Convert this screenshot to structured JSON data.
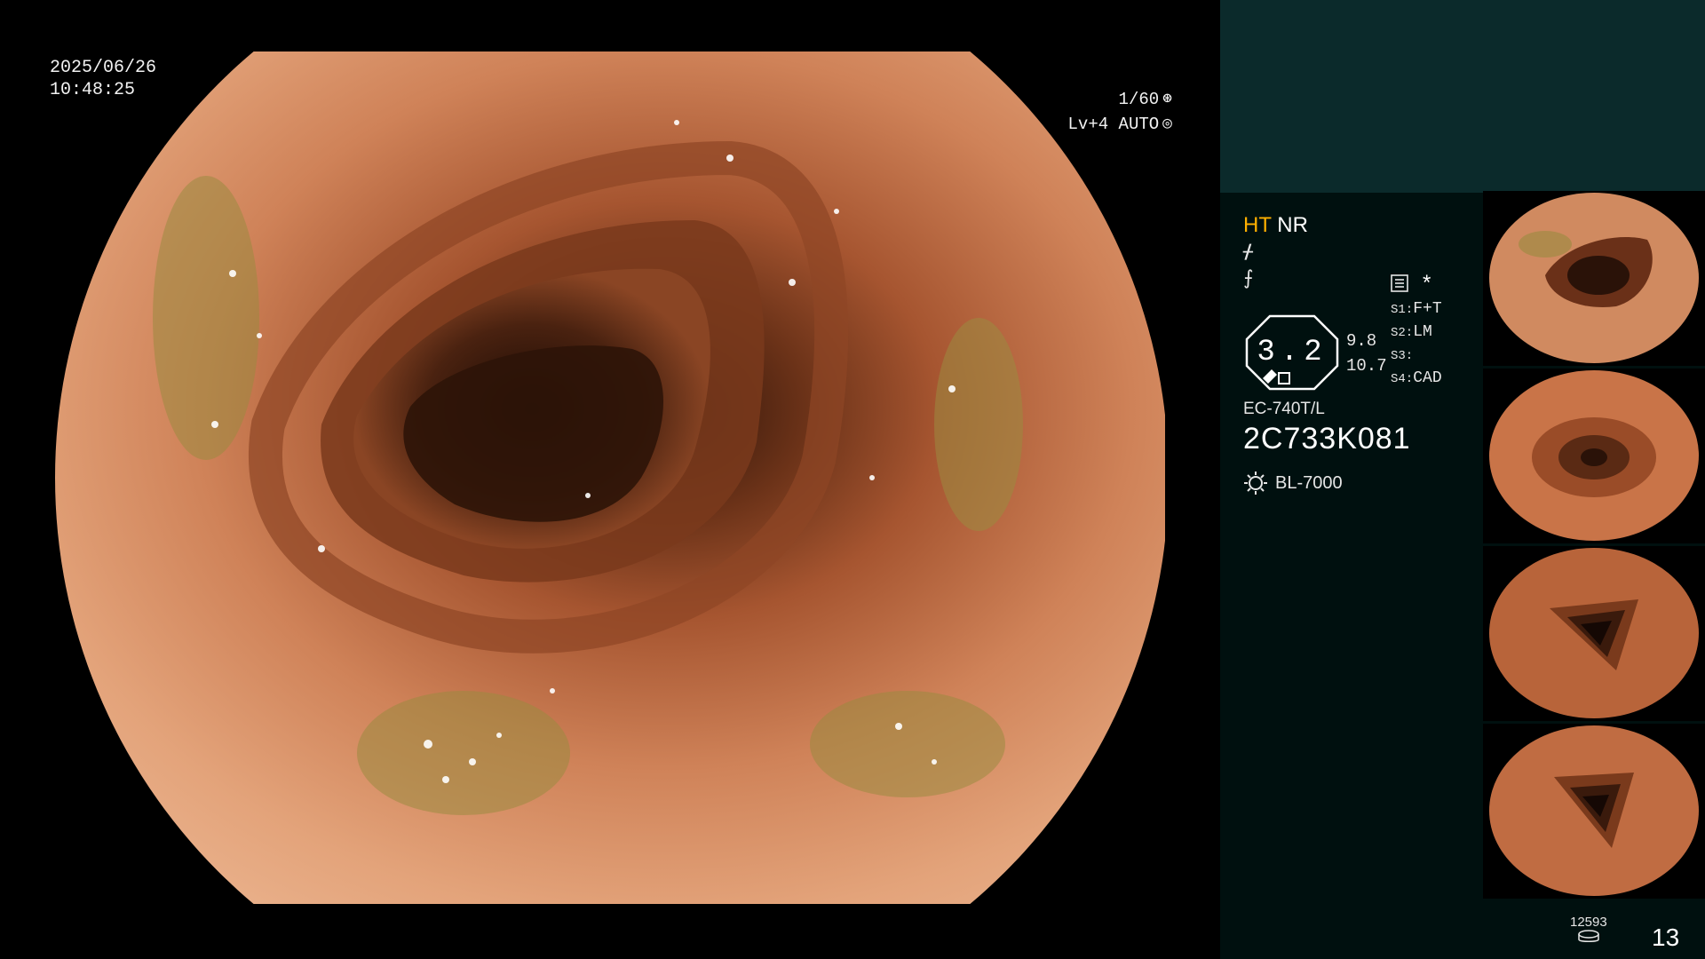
{
  "overlay": {
    "date": "2025/06/26",
    "time": "10:48:25",
    "shutter": "1/60",
    "level": "Lv+4 AUTO"
  },
  "panel": {
    "mode_ht": "HT",
    "mode_nr": "NR",
    "gauge_value": "3.2",
    "num_top": "9.8",
    "num_bottom": "10.7",
    "menu": [
      {
        "key": "S1:",
        "value": "F+T"
      },
      {
        "key": "S2:",
        "value": "LM"
      },
      {
        "key": "S3:",
        "value": ""
      },
      {
        "key": "S4:",
        "value": "CAD"
      }
    ],
    "asterisk": "*",
    "model": "EC-740T/L",
    "serial": "2C733K081",
    "light_source": "BL-7000",
    "counter": "12593",
    "image_count": "13"
  },
  "colors": {
    "accent": "#ffb000",
    "panel_bg": "#00100f",
    "panel_top": "#0b2a2b",
    "tissue": "#c9744a"
  },
  "icons": {
    "shutter": "aperture-icon",
    "auto": "iris-icon",
    "structure": "structure-enhance-icon",
    "color": "color-mode-icon",
    "menu": "menu-list-icon",
    "light": "light-bulb-icon",
    "disk": "storage-disk-icon"
  }
}
